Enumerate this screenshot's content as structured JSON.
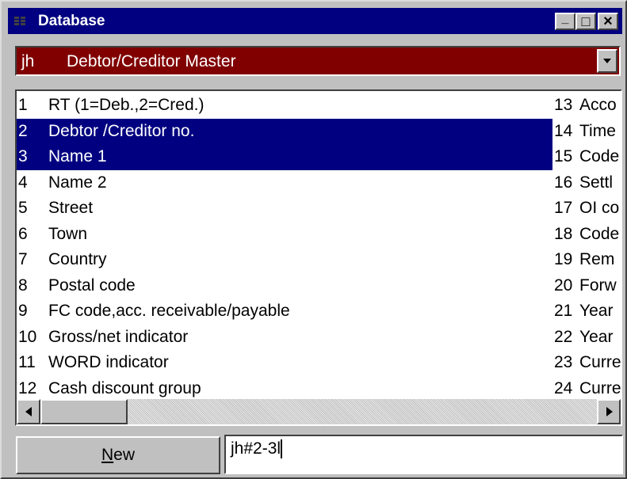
{
  "window": {
    "title": "Database",
    "minimize": "_",
    "maximize": "□",
    "close": "×"
  },
  "combo": {
    "code": "jh",
    "label": "Debtor/Creditor Master"
  },
  "fields_left": [
    {
      "num": "1",
      "label": "RT (1=Deb.,2=Cred.)",
      "selected": false
    },
    {
      "num": "2",
      "label": "Debtor /Creditor no.",
      "selected": true
    },
    {
      "num": "3",
      "label": "Name 1",
      "selected": true
    },
    {
      "num": "4",
      "label": "Name 2",
      "selected": false
    },
    {
      "num": "5",
      "label": "Street",
      "selected": false
    },
    {
      "num": "6",
      "label": "Town",
      "selected": false
    },
    {
      "num": "7",
      "label": "Country",
      "selected": false
    },
    {
      "num": "8",
      "label": "Postal code",
      "selected": false
    },
    {
      "num": "9",
      "label": "FC code,acc. receivable/payable",
      "selected": false
    },
    {
      "num": "10",
      "label": "Gross/net indicator",
      "selected": false
    },
    {
      "num": "11",
      "label": "WORD indicator",
      "selected": false
    },
    {
      "num": "12",
      "label": "Cash discount group",
      "selected": false
    }
  ],
  "fields_right": [
    {
      "num": "13",
      "label": "Acco"
    },
    {
      "num": "14",
      "label": "Time"
    },
    {
      "num": "15",
      "label": "Code"
    },
    {
      "num": "16",
      "label": "Settl"
    },
    {
      "num": "17",
      "label": "OI co"
    },
    {
      "num": "18",
      "label": "Code"
    },
    {
      "num": "19",
      "label": "Rem"
    },
    {
      "num": "20",
      "label": "Forw"
    },
    {
      "num": "21",
      "label": "Year"
    },
    {
      "num": "22",
      "label": "Year"
    },
    {
      "num": "23",
      "label": "Curre"
    },
    {
      "num": "24",
      "label": "Curre"
    }
  ],
  "new_button": {
    "underlined": "N",
    "rest": "ew"
  },
  "query_input": {
    "value": "jh#2-3l"
  }
}
